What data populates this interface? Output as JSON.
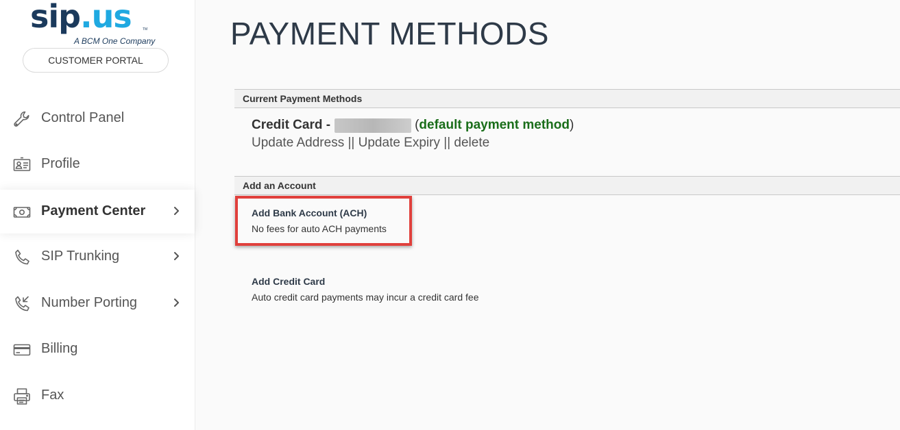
{
  "colors": {
    "brand_navy": "#1b3a5c",
    "brand_cyan": "#1fa9e1",
    "default_green": "#1a6e1a",
    "highlight_red": "#e0403c"
  },
  "sidebar": {
    "logo": {
      "part1": "sip",
      "dot": ".",
      "part2": "us",
      "tm": "TM",
      "tagline": "A BCM One Company"
    },
    "portal_label": "CUSTOMER PORTAL",
    "items": [
      {
        "label": "Control Panel",
        "icon": "wrench-icon",
        "chevron": false,
        "active": false
      },
      {
        "label": "Profile",
        "icon": "id-card-icon",
        "chevron": false,
        "active": false
      },
      {
        "label": "Payment Center",
        "icon": "money-icon",
        "chevron": true,
        "active": true
      },
      {
        "label": "SIP Trunking",
        "icon": "phone-icon",
        "chevron": true,
        "active": false
      },
      {
        "label": "Number Porting",
        "icon": "phone-incoming-icon",
        "chevron": true,
        "active": false
      },
      {
        "label": "Billing",
        "icon": "credit-card-icon",
        "chevron": false,
        "active": false
      },
      {
        "label": "Fax",
        "icon": "printer-icon",
        "chevron": false,
        "active": false
      }
    ]
  },
  "main": {
    "title": "PAYMENT METHODS",
    "current_section": {
      "header": "Current Payment Methods",
      "credit_card": {
        "label": "Credit Card -",
        "open_paren": "(",
        "default_text": "default payment method",
        "close_paren": ")"
      },
      "links": {
        "update_address": "Update Address",
        "separator": "||",
        "update_expiry": "Update Expiry",
        "delete": "delete"
      }
    },
    "add_section": {
      "header": "Add an Account",
      "options": [
        {
          "title": "Add Bank Account (ACH)",
          "desc": "No fees for auto ACH payments",
          "highlighted": true
        },
        {
          "title": "Add Credit Card",
          "desc": "Auto credit card payments may incur a credit card fee",
          "highlighted": false
        }
      ]
    }
  }
}
